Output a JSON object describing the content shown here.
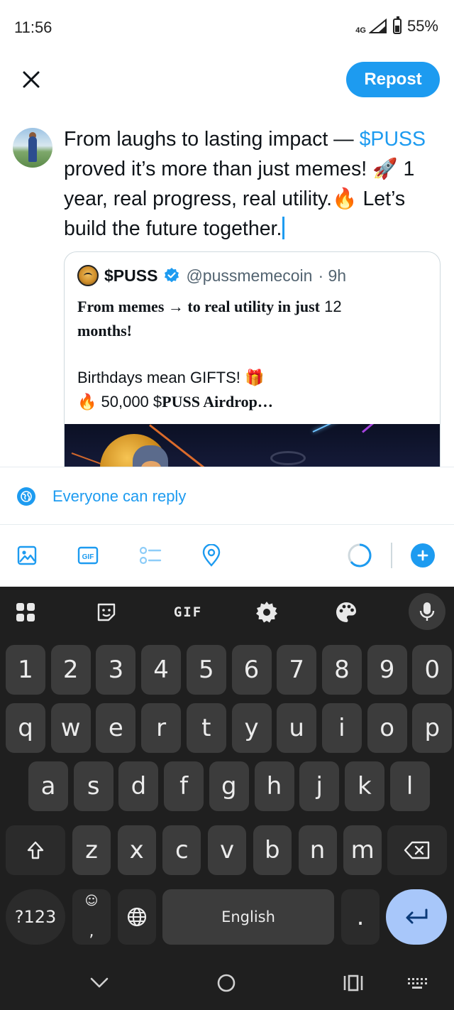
{
  "status_bar": {
    "time": "11:56",
    "network": "4G",
    "battery": "55%",
    "battery_level": 0.55
  },
  "header": {
    "repost_label": "Repost"
  },
  "composer": {
    "text_part1": "From laughs to lasting impact — ",
    "mention": "$PUSS",
    "text_part2": " proved it’s more than just memes! 🚀 1 year, real progress, real utility.🔥 Let’s build the future together."
  },
  "quote": {
    "name": "$PUSS",
    "handle": "@pussmemecoin",
    "time": "· 9h",
    "line1_bold": "From memes → to real utility in just",
    "line1_num": " 12",
    "line2_bold": "months!",
    "line3": "Birthdays mean GIFTS! 🎁",
    "line4_prefix": "🔥 50,000 $",
    "line4_bold": "PUSS Airdrop…"
  },
  "reply_settings": {
    "label": "Everyone can reply"
  },
  "toolbar": {
    "icons": [
      "image-icon",
      "gif-icon",
      "poll-icon",
      "location-icon"
    ],
    "gif_label": "GIF",
    "accent_color": "#1d9bf0"
  },
  "keyboard": {
    "gif_label": "GIF",
    "row_numbers": [
      "1",
      "2",
      "3",
      "4",
      "5",
      "6",
      "7",
      "8",
      "9",
      "0"
    ],
    "row_top": [
      "q",
      "w",
      "e",
      "r",
      "t",
      "y",
      "u",
      "i",
      "o",
      "p"
    ],
    "row_home": [
      "a",
      "s",
      "d",
      "f",
      "g",
      "h",
      "j",
      "k",
      "l"
    ],
    "row_bottom": [
      "z",
      "x",
      "c",
      "v",
      "b",
      "n",
      "m"
    ],
    "symbols_label": "?123",
    "comma_label": ",",
    "space_label": "English",
    "period_label": "."
  }
}
